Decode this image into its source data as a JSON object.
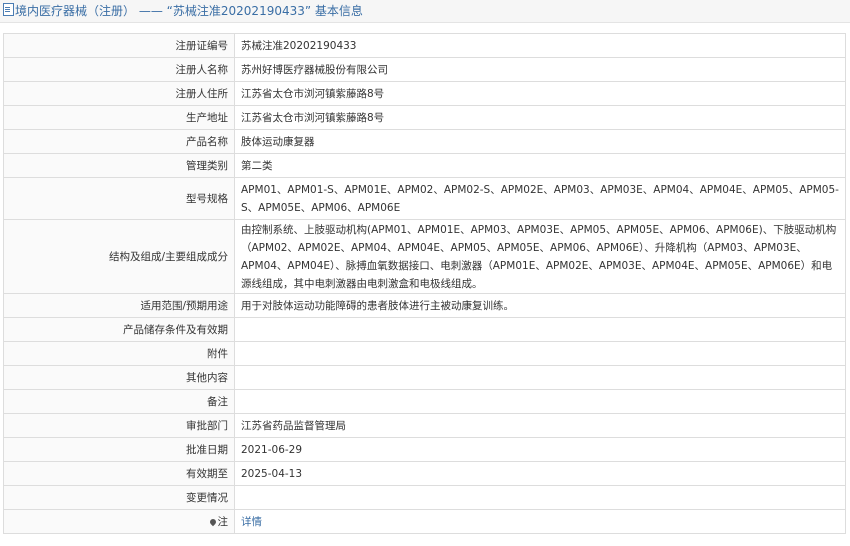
{
  "title": {
    "icon": "document-icon",
    "prefix": "境内医疗器械（注册）",
    "separator": "——",
    "number_quoted": "“苏械注准20202190433”",
    "suffix": "基本信息"
  },
  "rows": [
    {
      "label": "注册证编号",
      "value": "苏械注准20202190433"
    },
    {
      "label": "注册人名称",
      "value": "苏州好博医疗器械股份有限公司"
    },
    {
      "label": "注册人住所",
      "value": "江苏省太仓市浏河镇紫藤路8号"
    },
    {
      "label": "生产地址",
      "value": "江苏省太仓市浏河镇紫藤路8号"
    },
    {
      "label": "产品名称",
      "value": "肢体运动康复器"
    },
    {
      "label": "管理类别",
      "value": "第二类"
    },
    {
      "label": "型号规格",
      "value": "APM01、APM01-S、APM01E、APM02、APM02-S、APM02E、APM03、APM03E、APM04、APM04E、APM05、APM05-S、APM05E、APM06、APM06E"
    },
    {
      "label": "结构及组成/主要组成成分",
      "value": "由控制系统、上肢驱动机构(APM01、APM01E、APM03、APM03E、APM05、APM05E、APM06、APM06E)、下肢驱动机构（APM02、APM02E、APM04、APM04E、APM05、APM05E、APM06、APM06E）、升降机构（APM03、APM03E、APM04、APM04E）、脉搏血氧数据接口、电刺激器（APM01E、APM02E、APM03E、APM04E、APM05E、APM06E）和电源线组成，其中电刺激器由电刺激盒和电极线组成。"
    },
    {
      "label": "适用范围/预期用途",
      "value": "用于对肢体运动功能障碍的患者肢体进行主被动康复训练。"
    },
    {
      "label": "产品储存条件及有效期",
      "value": ""
    },
    {
      "label": "附件",
      "value": ""
    },
    {
      "label": "其他内容",
      "value": ""
    },
    {
      "label": "备注",
      "value": ""
    },
    {
      "label": "审批部门",
      "value": "江苏省药品监督管理局"
    },
    {
      "label": "批准日期",
      "value": "2021-06-29"
    },
    {
      "label": "有效期至",
      "value": "2025-04-13"
    },
    {
      "label": "变更情况",
      "value": ""
    }
  ],
  "note_row": {
    "label": "注",
    "icon": "pin-icon",
    "link": "详情"
  }
}
